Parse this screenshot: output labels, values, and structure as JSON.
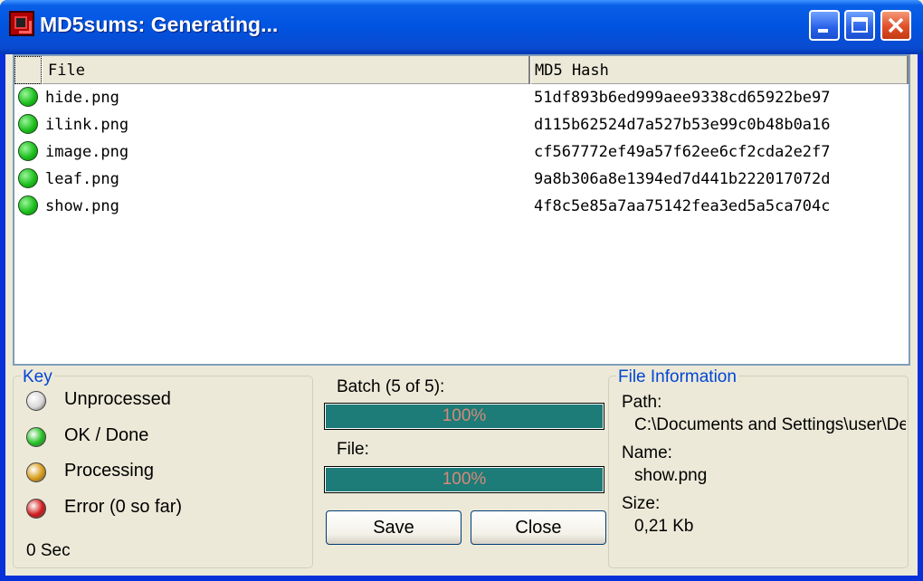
{
  "window": {
    "title": "MD5sums: Generating..."
  },
  "list": {
    "headers": {
      "file": "File",
      "hash": "MD5 Hash"
    },
    "rows": [
      {
        "file": "hide.png",
        "hash": "51df893b6ed999aee9338cd65922be97",
        "status": "ok"
      },
      {
        "file": "ilink.png",
        "hash": "d115b62524d7a527b53e99c0b48b0a16",
        "status": "ok"
      },
      {
        "file": "image.png",
        "hash": "cf567772ef49a57f62ee6cf2cda2e2f7",
        "status": "ok"
      },
      {
        "file": "leaf.png",
        "hash": "9a8b306a8e1394ed7d441b222017072d",
        "status": "ok"
      },
      {
        "file": "show.png",
        "hash": "4f8c5e85a7aa75142fea3ed5a5ca704c",
        "status": "ok"
      }
    ]
  },
  "key": {
    "legend": "Key",
    "items": [
      {
        "label": "Unprocessed",
        "color": "#d8d8d8"
      },
      {
        "label": "OK / Done",
        "color": "#1ec01e"
      },
      {
        "label": "Processing",
        "color": "#d89a14"
      },
      {
        "label": "Error (0 so far)",
        "color": "#d01818"
      }
    ],
    "elapsed": "0 Sec"
  },
  "progress": {
    "batch_label": "Batch (5 of 5):",
    "batch_value": 1.0,
    "batch_text": "100%",
    "file_label": "File:",
    "file_value": 1.0,
    "file_text": "100%",
    "save_label": "Save",
    "close_label": "Close"
  },
  "info": {
    "legend": "File Information",
    "path_label": "Path:",
    "path_value": "C:\\Documents and Settings\\user\\De",
    "name_label": "Name:",
    "name_value": "show.png",
    "size_label": "Size:",
    "size_value": "0,21 Kb"
  },
  "colors": {
    "ok": "#1ec01e",
    "progress_fill": "#1d7b78",
    "titlebar": "#0053e0",
    "legend_text": "#0046d5"
  }
}
